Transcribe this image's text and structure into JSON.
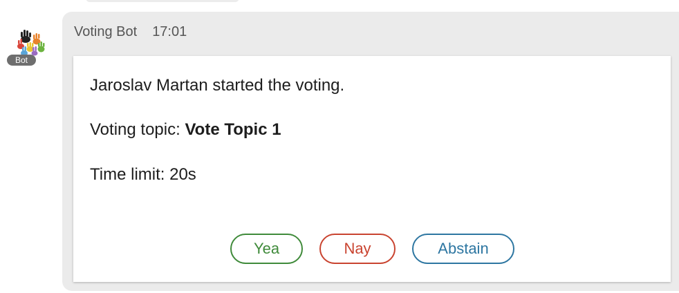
{
  "sender": {
    "name": "Voting Bot",
    "time": "17:01",
    "badge": "Bot",
    "avatar_icon": "raised-hands-icon"
  },
  "card": {
    "announcement": "Jaroslav Martan started the voting.",
    "topic_label": "Voting topic: ",
    "topic_value": "Vote Topic 1",
    "time_limit": "Time limit: 20s"
  },
  "buttons": {
    "yea": "Yea",
    "nay": "Nay",
    "abstain": "Abstain"
  },
  "colors": {
    "yea": "#3f8a3a",
    "nay": "#c9432f",
    "abstain": "#2d76a1",
    "bubble": "#ebebeb"
  }
}
